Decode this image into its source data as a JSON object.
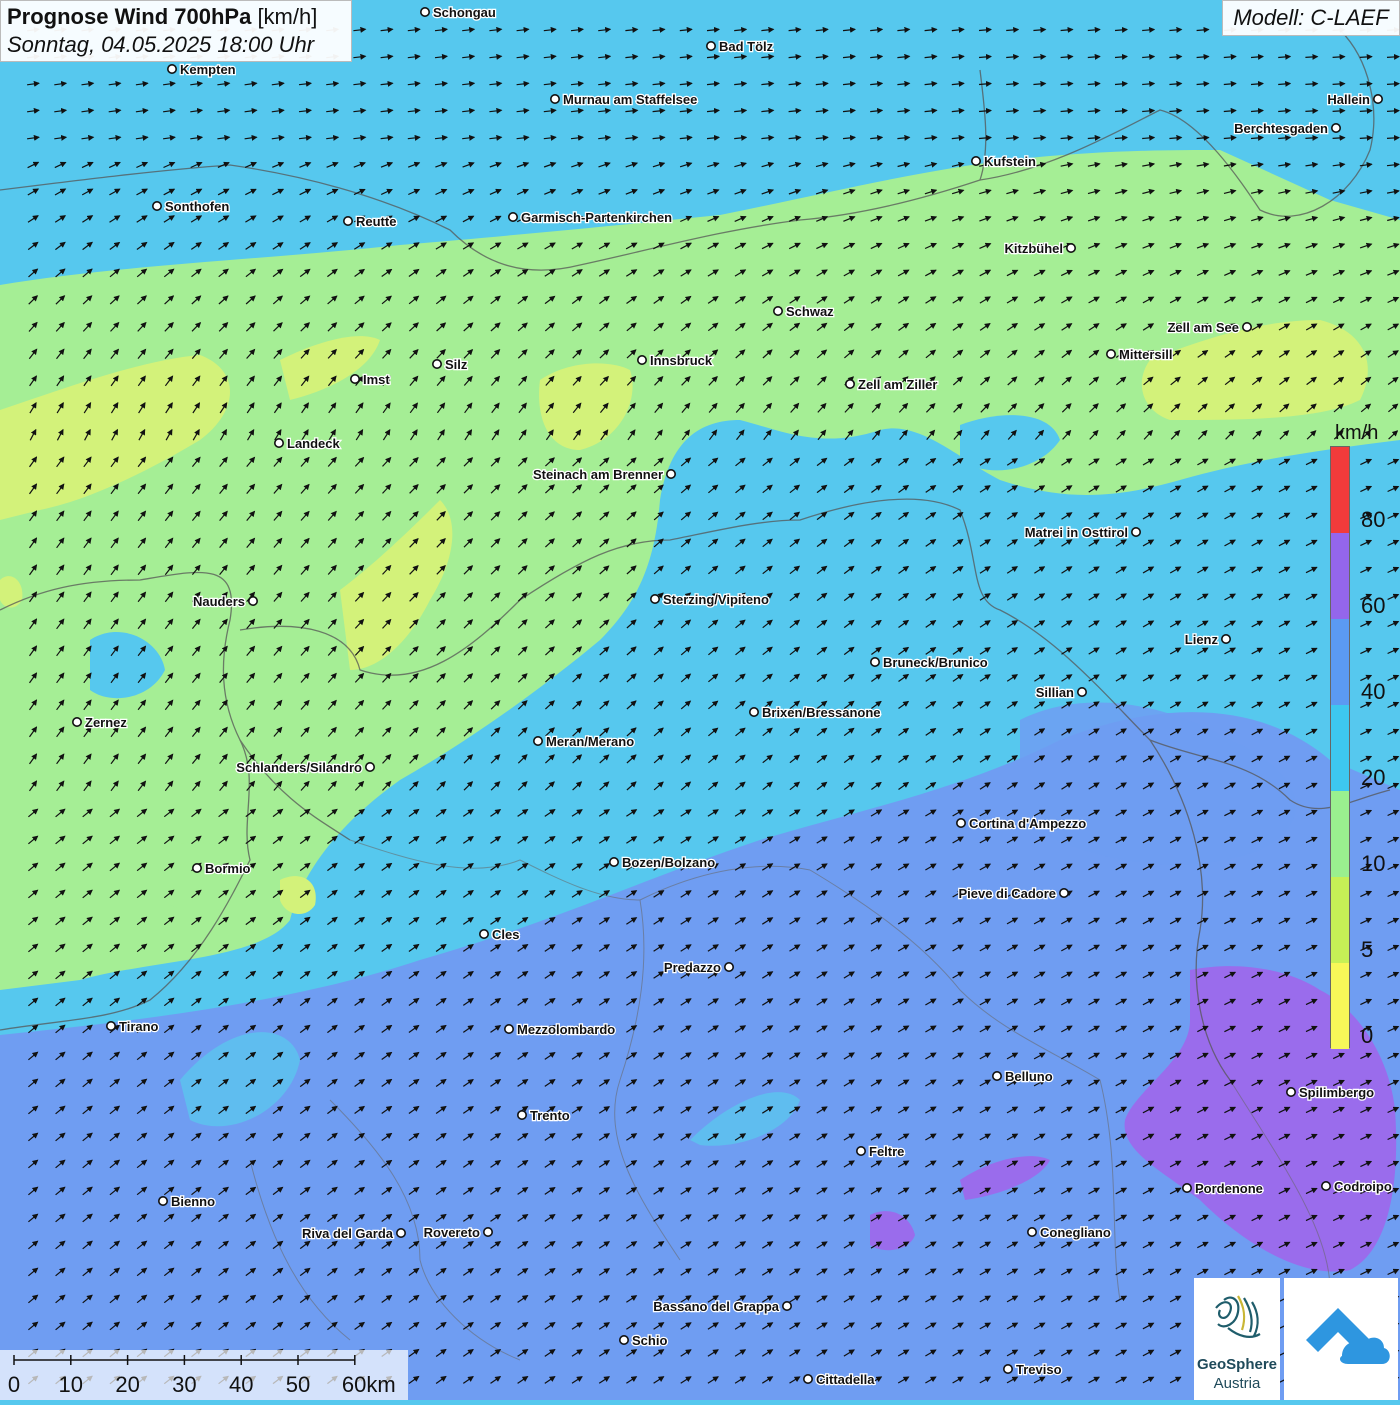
{
  "header": {
    "title_bold": "Prognose Wind 700hPa",
    "title_unit": "[km/h]",
    "subtitle": "Sonntag, 04.05.2025 18:00 Uhr",
    "model": "Modell: C-LAEF"
  },
  "legend": {
    "unit": "km/h",
    "classes": [
      {
        "label": "0",
        "color": "#f7f758"
      },
      {
        "label": "5",
        "color": "#c6f056"
      },
      {
        "label": "10",
        "color": "#9af08f"
      },
      {
        "label": "20",
        "color": "#3dc7f0"
      },
      {
        "label": "40",
        "color": "#5b9af3"
      },
      {
        "label": "60",
        "color": "#9466ec"
      },
      {
        "label": "80",
        "color": "#f23b3b"
      }
    ]
  },
  "scale_bar": {
    "labels": [
      "0",
      "10",
      "20",
      "30",
      "40",
      "50",
      "60km"
    ]
  },
  "logos": {
    "geosphere_line1": "GeoSphere",
    "geosphere_line2": "Austria",
    "weather_logo": "cloud-arrow-icon"
  },
  "colors": {
    "calm_yellow": "#e8f07a",
    "light_green": "#a6ef94",
    "cyan": "#56c8ee",
    "blue": "#6e9bf2",
    "violet": "#9a6cec"
  },
  "cities": [
    {
      "name": "Schongau"
    },
    {
      "name": "Bad Tölz"
    },
    {
      "name": "Kempten"
    },
    {
      "name": "Murnau am Staffelsee"
    },
    {
      "name": "Hallein"
    },
    {
      "name": "Berchtesgaden"
    },
    {
      "name": "Kufstein"
    },
    {
      "name": "Sonthofen"
    },
    {
      "name": "Reutte"
    },
    {
      "name": "Garmisch-Partenkirchen"
    },
    {
      "name": "Kitzbühel"
    },
    {
      "name": "Schwaz"
    },
    {
      "name": "Zell am See"
    },
    {
      "name": "Mittersill"
    },
    {
      "name": "Silz"
    },
    {
      "name": "Innsbruck"
    },
    {
      "name": "Imst"
    },
    {
      "name": "Zell am Ziller"
    },
    {
      "name": "Landeck"
    },
    {
      "name": "Steinach am Brenner"
    },
    {
      "name": "Matrei in Osttirol"
    },
    {
      "name": "Nauders"
    },
    {
      "name": "Sterzing/Vipiteno"
    },
    {
      "name": "Lienz"
    },
    {
      "name": "Bruneck/Brunico"
    },
    {
      "name": "Sillian"
    },
    {
      "name": "Zernez"
    },
    {
      "name": "Brixen/Bressanone"
    },
    {
      "name": "Meran/Merano"
    },
    {
      "name": "Schlanders/Silandro"
    },
    {
      "name": "Cortina d'Ampezzo"
    },
    {
      "name": "Bozen/Bolzano"
    },
    {
      "name": "Bormio"
    },
    {
      "name": "Pieve di Cadore"
    },
    {
      "name": "Cles"
    },
    {
      "name": "Predazzo"
    },
    {
      "name": "Tirano"
    },
    {
      "name": "Mezzolombardo"
    },
    {
      "name": "Belluno"
    },
    {
      "name": "Spilimbergo"
    },
    {
      "name": "Trento"
    },
    {
      "name": "Feltre"
    },
    {
      "name": "Pordenone"
    },
    {
      "name": "Codroipo"
    },
    {
      "name": "Bienno"
    },
    {
      "name": "Riva del Garda"
    },
    {
      "name": "Rovereto"
    },
    {
      "name": "Conegliano"
    },
    {
      "name": "Bassano del Grappa"
    },
    {
      "name": "Schio"
    },
    {
      "name": "Treviso"
    },
    {
      "name": "Cittadella"
    }
  ]
}
